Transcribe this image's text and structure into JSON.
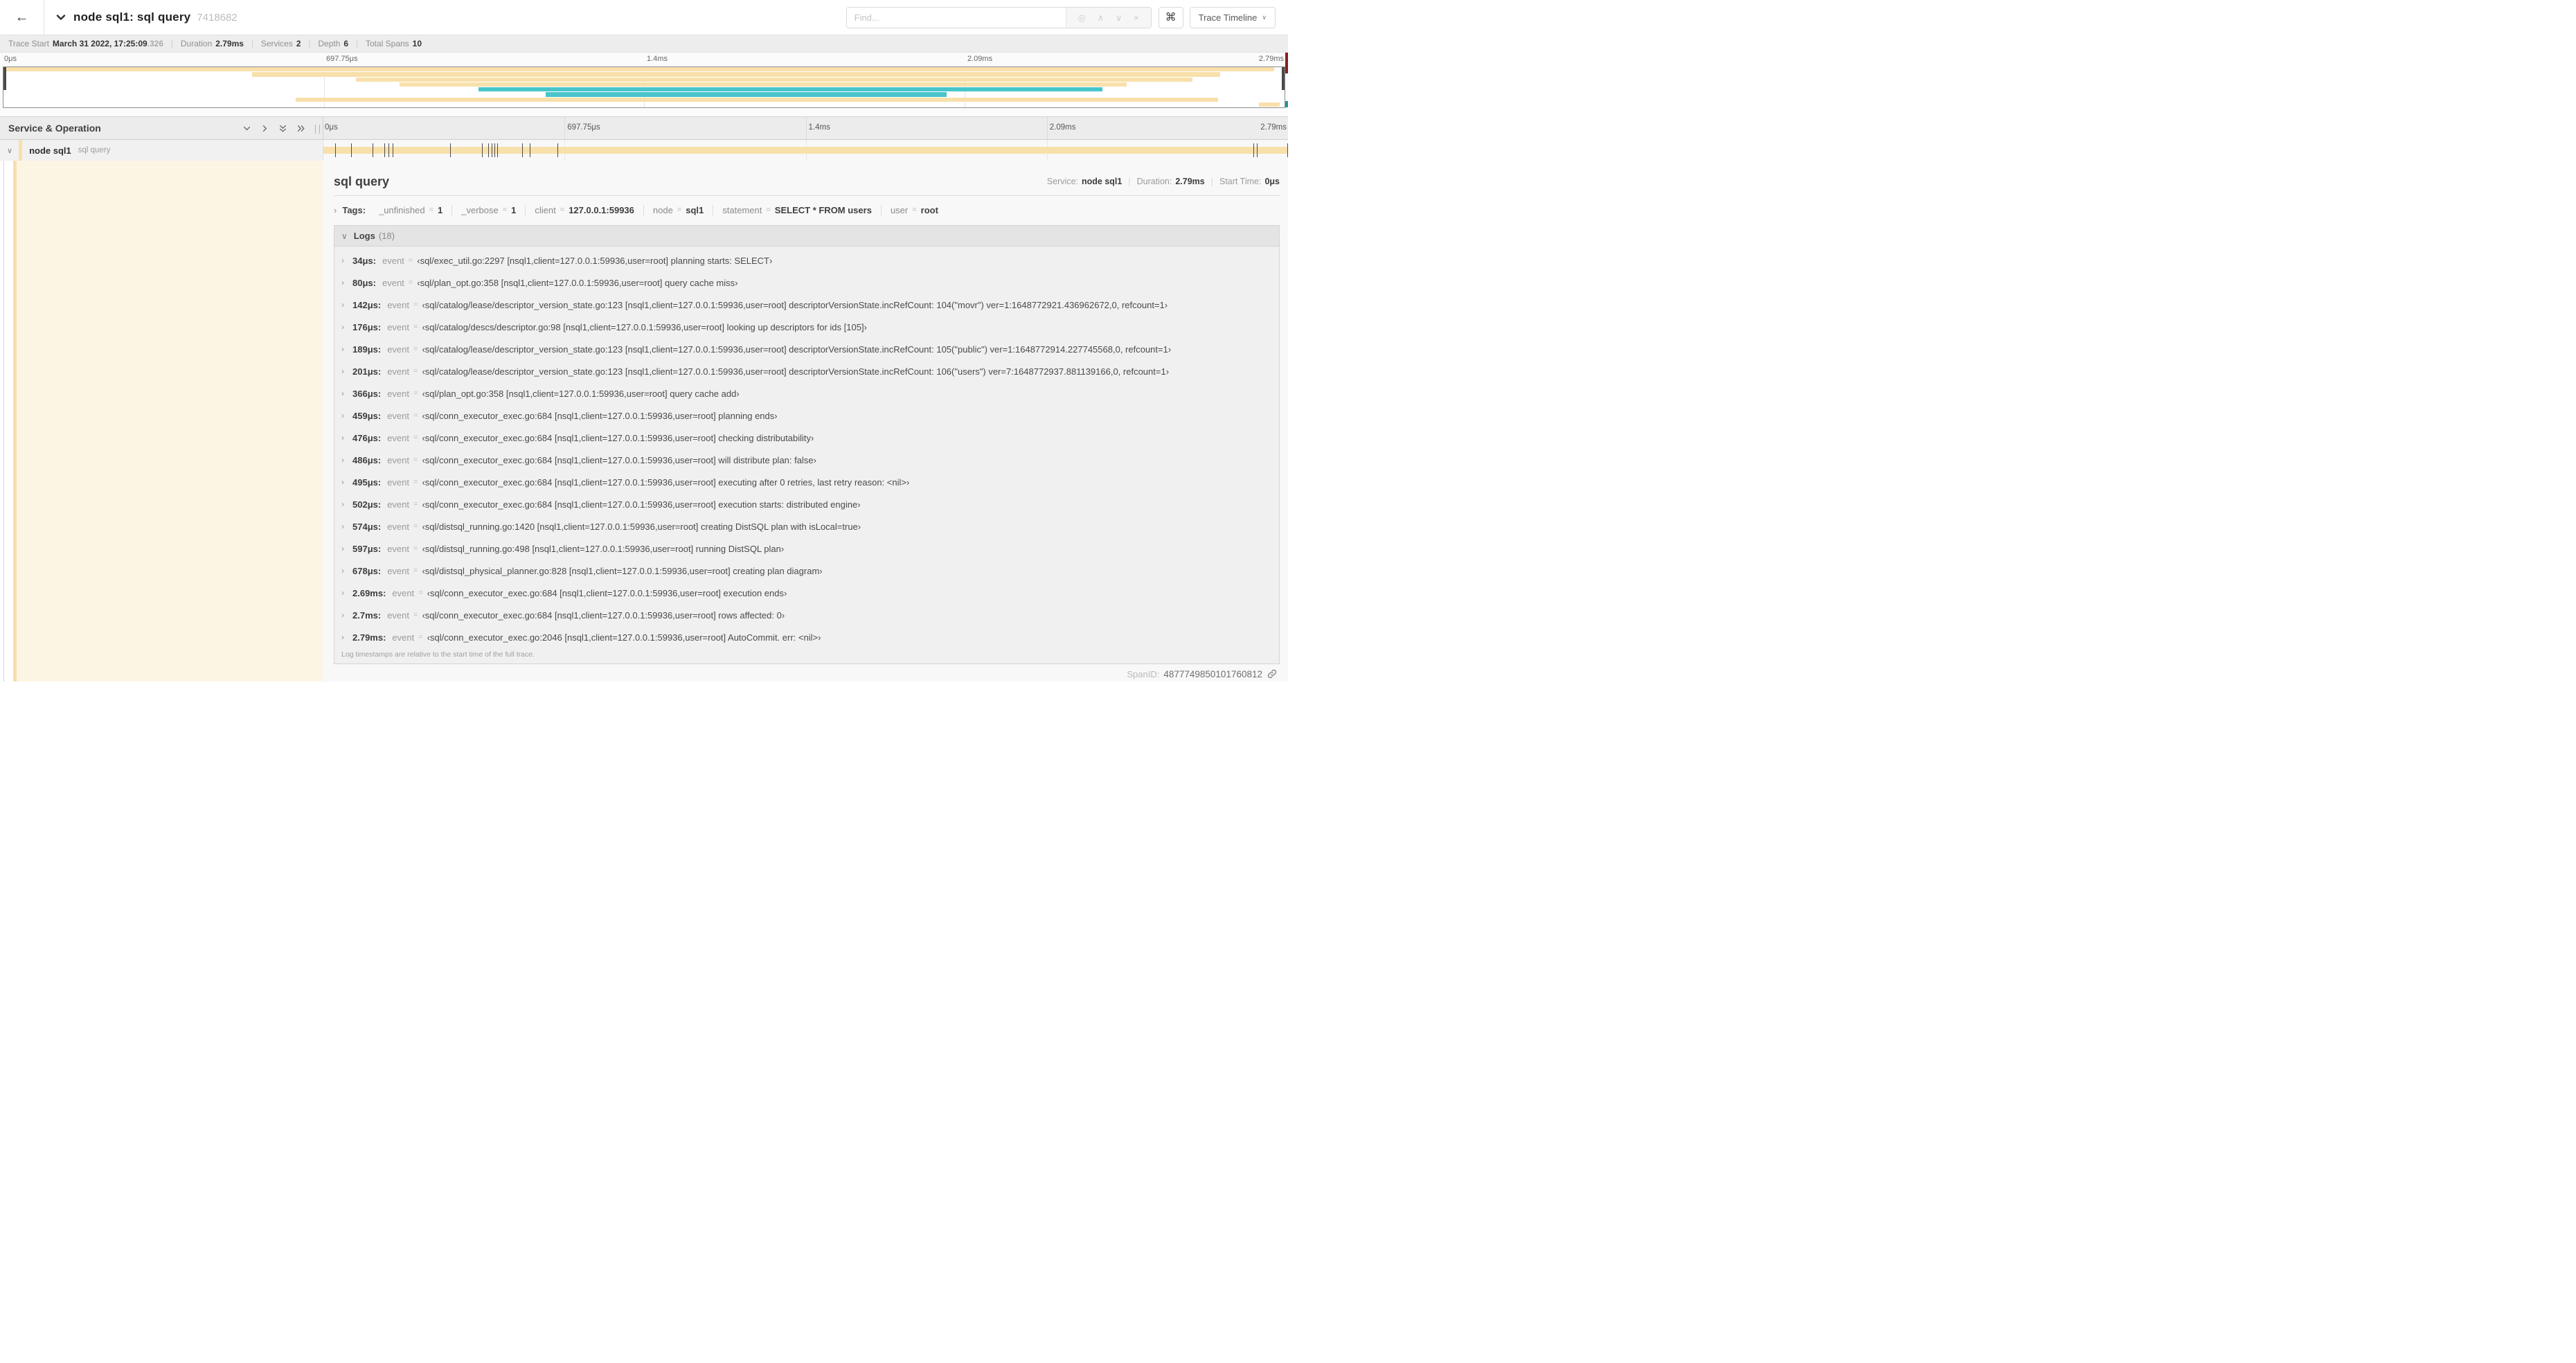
{
  "icons": {
    "back": "←",
    "locate": "◎",
    "prev": "∧",
    "next": "∨",
    "clear": "×",
    "command": "⌘",
    "caret": "∨",
    "chevron_down": "∨",
    "chevron_right": "›",
    "pipe": "|"
  },
  "header": {
    "title": "node sql1: sql query",
    "trace_id": "7418682",
    "find_placeholder": "Find...",
    "view_selector": "Trace Timeline"
  },
  "trace_info": [
    {
      "label": "Trace Start",
      "value": "March 31 2022, 17:25:09",
      "suffix": ".326"
    },
    {
      "label": "Duration",
      "value": "2.79ms"
    },
    {
      "label": "Services",
      "value": "2"
    },
    {
      "label": "Depth",
      "value": "6"
    },
    {
      "label": "Total Spans",
      "value": "10"
    }
  ],
  "timeline_ticks": [
    "0μs",
    "697.75μs",
    "1.4ms",
    "2.09ms",
    "2.79ms"
  ],
  "colors": {
    "tan": "#f8e0ab",
    "teal": "#48c5cb",
    "cream": "#fdf5e4"
  },
  "minimap_rows": [
    {
      "start": 0.0,
      "end": 0.992,
      "color": "#f8e0ab"
    },
    {
      "start": 0.194,
      "end": 0.95,
      "color": "#f8e0ab"
    },
    {
      "start": 0.275,
      "end": 0.928,
      "color": "#f8e0ab"
    },
    {
      "start": 0.309,
      "end": 0.877,
      "color": "#f8e0ab"
    },
    {
      "start": 0.371,
      "end": 0.858,
      "color": "#48c5cb"
    },
    {
      "start": 0.423,
      "end": 0.736,
      "color": "#48c5cb"
    },
    {
      "start": 0.228,
      "end": 0.948,
      "color": "#f8e0ab"
    },
    {
      "start": 0.98,
      "end": 0.996,
      "color": "#f8e0ab"
    }
  ],
  "service_panel": {
    "title": "Service & Operation"
  },
  "span_row": {
    "service": "node sql1",
    "operation": "sql query",
    "bar_color": "#f8e0ab",
    "tick_fractions": [
      0.0122,
      0.0287,
      0.0509,
      0.0631,
      0.0677,
      0.072,
      0.1312,
      0.1645,
      0.1706,
      0.1742,
      0.1774,
      0.1799,
      0.2057,
      0.214,
      0.243,
      0.9642,
      0.9677,
      0.999
    ]
  },
  "detail": {
    "operation": "sql query",
    "meta": [
      {
        "label": "Service:",
        "value": "node sql1"
      },
      {
        "label": "Duration:",
        "value": "2.79ms"
      },
      {
        "label": "Start Time:",
        "value": "0μs"
      }
    ],
    "tags_label": "Tags:",
    "tags": [
      {
        "key": "_unfinished",
        "value": "1"
      },
      {
        "key": "_verbose",
        "value": "1"
      },
      {
        "key": "client",
        "value": "127.0.0.1:59936"
      },
      {
        "key": "node",
        "value": "sql1"
      },
      {
        "key": "statement",
        "value": "SELECT * FROM users"
      },
      {
        "key": "user",
        "value": "root"
      }
    ],
    "logs_title": "Logs",
    "logs_count": "(18)",
    "logs": [
      {
        "time": "34μs:",
        "key": "event",
        "value": "‹sql/exec_util.go:2297 [nsql1,client=127.0.0.1:59936,user=root] planning starts: SELECT›"
      },
      {
        "time": "80μs:",
        "key": "event",
        "value": "‹sql/plan_opt.go:358 [nsql1,client=127.0.0.1:59936,user=root] query cache miss›"
      },
      {
        "time": "142μs:",
        "key": "event",
        "value": "‹sql/catalog/lease/descriptor_version_state.go:123 [nsql1,client=127.0.0.1:59936,user=root] descriptorVersionState.incRefCount: 104(\"movr\") ver=1:1648772921.436962672,0, refcount=1›"
      },
      {
        "time": "176μs:",
        "key": "event",
        "value": "‹sql/catalog/descs/descriptor.go:98 [nsql1,client=127.0.0.1:59936,user=root] looking up descriptors for ids [105]›"
      },
      {
        "time": "189μs:",
        "key": "event",
        "value": "‹sql/catalog/lease/descriptor_version_state.go:123 [nsql1,client=127.0.0.1:59936,user=root] descriptorVersionState.incRefCount: 105(\"public\") ver=1:1648772914.227745568,0, refcount=1›"
      },
      {
        "time": "201μs:",
        "key": "event",
        "value": "‹sql/catalog/lease/descriptor_version_state.go:123 [nsql1,client=127.0.0.1:59936,user=root] descriptorVersionState.incRefCount: 106(\"users\") ver=7:1648772937.881139166,0, refcount=1›"
      },
      {
        "time": "366μs:",
        "key": "event",
        "value": "‹sql/plan_opt.go:358 [nsql1,client=127.0.0.1:59936,user=root] query cache add›"
      },
      {
        "time": "459μs:",
        "key": "event",
        "value": "‹sql/conn_executor_exec.go:684 [nsql1,client=127.0.0.1:59936,user=root] planning ends›"
      },
      {
        "time": "476μs:",
        "key": "event",
        "value": "‹sql/conn_executor_exec.go:684 [nsql1,client=127.0.0.1:59936,user=root] checking distributability›"
      },
      {
        "time": "486μs:",
        "key": "event",
        "value": "‹sql/conn_executor_exec.go:684 [nsql1,client=127.0.0.1:59936,user=root] will distribute plan: false›"
      },
      {
        "time": "495μs:",
        "key": "event",
        "value": "‹sql/conn_executor_exec.go:684 [nsql1,client=127.0.0.1:59936,user=root] executing after 0 retries, last retry reason: <nil>›"
      },
      {
        "time": "502μs:",
        "key": "event",
        "value": "‹sql/conn_executor_exec.go:684 [nsql1,client=127.0.0.1:59936,user=root] execution starts: distributed engine›"
      },
      {
        "time": "574μs:",
        "key": "event",
        "value": "‹sql/distsql_running.go:1420 [nsql1,client=127.0.0.1:59936,user=root] creating DistSQL plan with isLocal=true›"
      },
      {
        "time": "597μs:",
        "key": "event",
        "value": "‹sql/distsql_running.go:498 [nsql1,client=127.0.0.1:59936,user=root] running DistSQL plan›"
      },
      {
        "time": "678μs:",
        "key": "event",
        "value": "‹sql/distsql_physical_planner.go:828 [nsql1,client=127.0.0.1:59936,user=root] creating plan diagram›"
      },
      {
        "time": "2.69ms:",
        "key": "event",
        "value": "‹sql/conn_executor_exec.go:684 [nsql1,client=127.0.0.1:59936,user=root] execution ends›"
      },
      {
        "time": "2.7ms:",
        "key": "event",
        "value": "‹sql/conn_executor_exec.go:684 [nsql1,client=127.0.0.1:59936,user=root] rows affected: 0›"
      },
      {
        "time": "2.79ms:",
        "key": "event",
        "value": "‹sql/conn_executor_exec.go:2046 [nsql1,client=127.0.0.1:59936,user=root] AutoCommit. err: <nil>›"
      }
    ],
    "logs_note": "Log timestamps are relative to the start time of the full trace.",
    "span_id_label": "SpanID:",
    "span_id": "4877749850101760812"
  }
}
